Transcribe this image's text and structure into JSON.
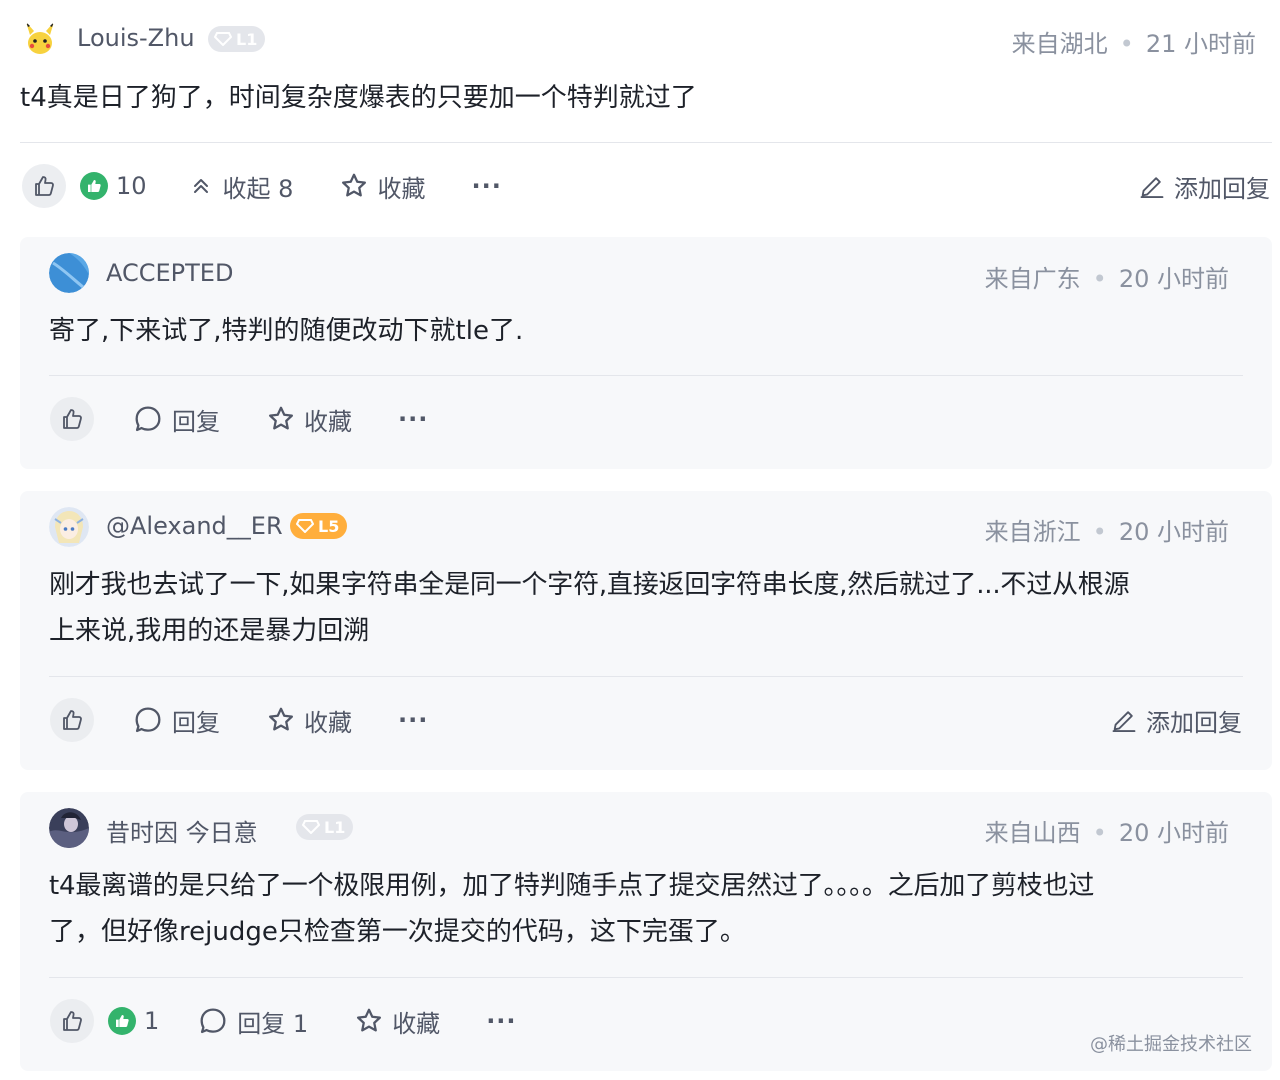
{
  "comments": [
    {
      "user": "Louis-Zhu",
      "level": "L1",
      "location": "来自湖北",
      "time": "21 小时前",
      "text": "t4真是日了狗了，时间复杂度爆表的只要加一个特判就过了",
      "likes": "10",
      "collapse_label": "收起 8",
      "favorite_label": "收藏",
      "more_label": "···",
      "add_reply_label": "添加回复",
      "replies": [
        {
          "user": "ACCEPTED",
          "location": "来自广东",
          "time": "20 小时前",
          "text": "寄了,下来试了,特判的随便改动下就tle了.",
          "reply_label": "回复",
          "favorite_label": "收藏",
          "more_label": "···"
        },
        {
          "user": "@Alexand__ER",
          "level": "L5",
          "location": "来自浙江",
          "time": "20 小时前",
          "text_line1": "刚才我也去试了一下,如果字符串全是同一个字符,直接返回字符串长度,然后就过了...不过从根源",
          "text_line2": "上来说,我用的还是暴力回溯",
          "reply_label": "回复",
          "favorite_label": "收藏",
          "more_label": "···",
          "add_reply_label": "添加回复"
        },
        {
          "user": "昔时因 今日意",
          "level": "L1",
          "location": "来自山西",
          "time": "20 小时前",
          "text_line1": "t4最离谱的是只给了一个极限用例，加了特判随手点了提交居然过了。。。。之后加了剪枝也过",
          "text_line2": "了，但好像rejudge只检查第一次提交的代码，这下完蛋了。",
          "likes": "1",
          "reply_label": "回复 1",
          "favorite_label": "收藏",
          "more_label": "···"
        }
      ]
    }
  ],
  "meta_separator": "•",
  "watermark": "@稀土掘金技术社区",
  "colors": {
    "like_green": "#33b36c",
    "level_orange": "#ffae3c",
    "card_bg": "#f7f8fa"
  }
}
